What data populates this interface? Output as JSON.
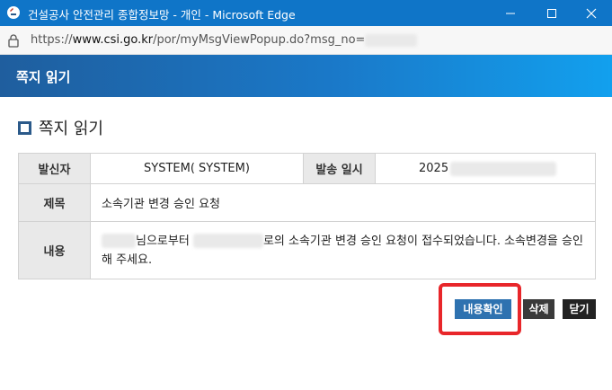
{
  "window": {
    "title": "건설공사 안전관리 종합정보망 - 개인 - Microsoft Edge",
    "icons": [
      "edge-icon",
      "minimize-icon",
      "maximize-icon",
      "close-icon"
    ]
  },
  "address": {
    "url_prefix": "https://",
    "url_domain": "www.csi.go.kr",
    "url_path": "/por/myMsgViewPopup.do?msg_no="
  },
  "popup": {
    "header": "쪽지 읽기",
    "section_title": "쪽지 읽기"
  },
  "message": {
    "sender_label": "발신자",
    "sender_value": "SYSTEM( SYSTEM)",
    "sent_label": "발송 일시",
    "sent_value": "2025",
    "subject_label": "제목",
    "subject_value": "소속기관 변경 승인 요청",
    "content_label": "내용",
    "content_part1": "님으로부터",
    "content_part2": "로의 소속기관 변경 승인 요청이 접수되었습니다. 소속변경을 승인해 주세요."
  },
  "buttons": {
    "confirm": "내용확인",
    "delete": "삭제",
    "close": "닫기"
  },
  "colors": {
    "titlebar": "#0f75c8",
    "header_gradient_start": "#1f5e9e",
    "header_gradient_end": "#12a0ee",
    "confirm_button": "#2e72b0",
    "highlight": "#e8262a"
  }
}
